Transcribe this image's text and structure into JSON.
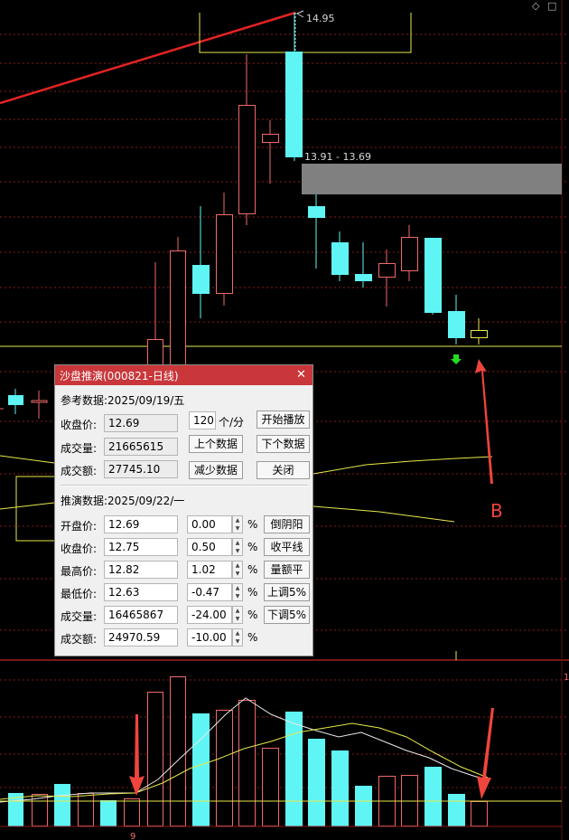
{
  "chart_labels": {
    "high_price": "14.95",
    "gap_range": "13.91 - 13.69",
    "annotation": "B",
    "axis_marker": "9"
  },
  "colors": {
    "up": "#f06a6a",
    "down": "#5ff5f5",
    "trendline": "#e32323",
    "ma": "#e8e84a",
    "gridline": "#8a1a1a",
    "zone": "#808080",
    "annotation": "#f0453c",
    "dialog_title_bg": "#c9373a"
  },
  "dialog": {
    "title": "沙盘推演(000821-日线)",
    "close": "✕",
    "reference": {
      "header": "参考数据:2025/09/19/五",
      "close_label": "收盘价:",
      "close_value": "12.69",
      "volume_label": "成交量:",
      "volume_value": "21665615",
      "amount_label": "成交额:",
      "amount_value": "27745.10",
      "speed_value": "120",
      "speed_unit": "个/分",
      "btn_play": "开始播放",
      "btn_prev": "上个数据",
      "btn_next": "下个数据",
      "btn_reduce": "减少数据",
      "btn_close": "关闭"
    },
    "projection": {
      "header": "推演数据:2025/09/22/一",
      "rows": [
        {
          "label": "开盘价:",
          "value": "12.69",
          "pct": "0.00",
          "button": "倒阴阳"
        },
        {
          "label": "收盘价:",
          "value": "12.75",
          "pct": "0.50",
          "button": "收平线"
        },
        {
          "label": "最高价:",
          "value": "12.82",
          "pct": "1.02",
          "button": "量额平"
        },
        {
          "label": "最低价:",
          "value": "12.63",
          "pct": "-0.47",
          "button": "上调5%"
        },
        {
          "label": "成交量:",
          "value": "16465867",
          "pct": "-24.00",
          "button": "下调5%"
        },
        {
          "label": "成交额:",
          "value": "24970.59",
          "pct": "-10.00",
          "button": ""
        }
      ],
      "pct_sign": "%"
    }
  }
}
